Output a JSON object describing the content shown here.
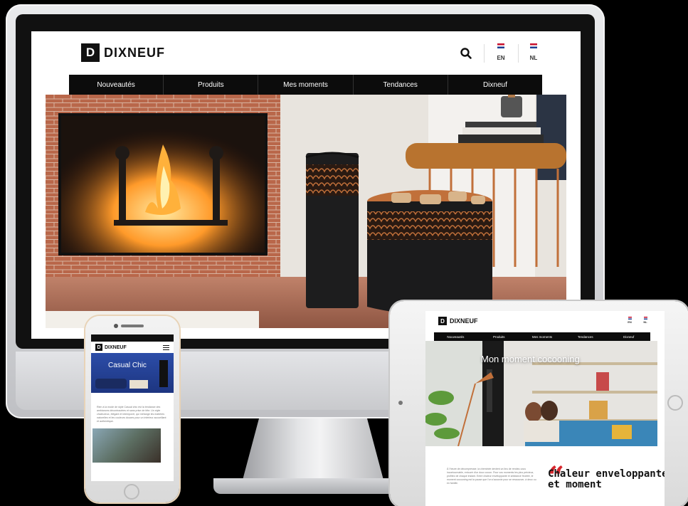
{
  "desktop": {
    "logo": {
      "mark": "D",
      "text": "DIXNEUF"
    },
    "languages": [
      {
        "code": "EN",
        "colors": [
          "#c8102e",
          "#1d3f91"
        ]
      },
      {
        "code": "NL",
        "colors": [
          "#c8102e",
          "#1d3f91"
        ]
      }
    ],
    "nav": [
      "Nouveautés",
      "Produits",
      "Mes moments",
      "Tendances",
      "Dixneuf"
    ]
  },
  "phone": {
    "logo": {
      "mark": "D",
      "text": "DIXNEUF"
    },
    "hero_title": "Casual Chic",
    "body_text": "Rien à la mode de style Casual chic est la tendance des ambiances décontractées et sans prise de tête. Un style chaleureux, élégant et intemporel, qui mélange les matières naturelles et les couleurs douces pour un intérieur accueillant et authentique."
  },
  "tablet": {
    "logo": {
      "mark": "D",
      "text": "DIXNEUF"
    },
    "languages": [
      {
        "code": "EN"
      },
      {
        "code": "NL"
      }
    ],
    "nav": [
      "Nouveautés",
      "Produits",
      "Mes moments",
      "Tendances",
      "Dixneuf"
    ],
    "hero_title": "Mon moment cocooning",
    "body_text": "À l'heure de décompresser, la cheminée devient un lieu de rendez-vous incontournable, entouré d'un doux cocon. Pour vos moments les plus précieux, profitez de chaque instant. Entre chaleur enveloppante et ambiance feutrée, le moment cocooning est la pause que l'on s'accorde pour se ressourcer, à deux ou en famille.",
    "quote_mark": "“",
    "quote_title": "Chaleur enveloppante et moment"
  },
  "colors": {
    "nav_bg": "#0c0c0c",
    "accent_red": "#d6262c",
    "copper": "#c1703a"
  }
}
